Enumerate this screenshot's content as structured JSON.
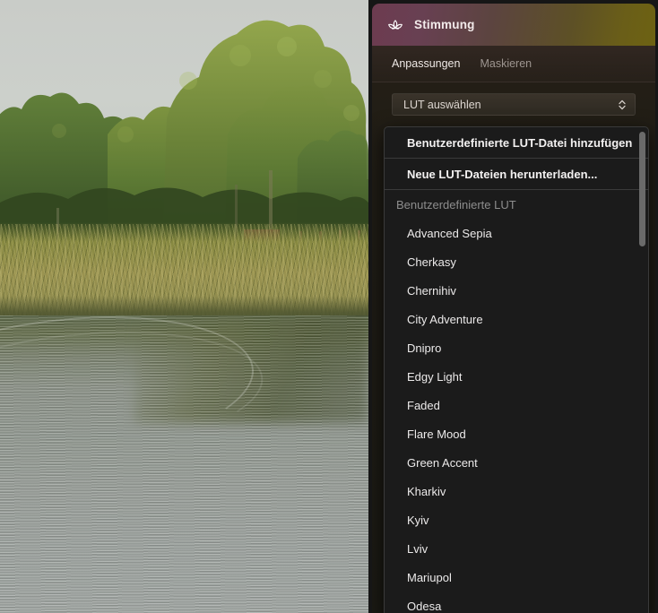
{
  "photo": {
    "alt_description": "Riverbank with green trees, golden reeds and rippled water"
  },
  "panel": {
    "header": {
      "icon": "lotus-icon",
      "title": "Stimmung"
    },
    "tabs": [
      {
        "label": "Anpassungen",
        "active": true
      },
      {
        "label": "Maskieren",
        "active": false
      }
    ],
    "select": {
      "label": "LUT auswählen",
      "icon": "chevron-updown-icon"
    },
    "dropdown": {
      "actions": [
        "Benutzerdefinierte LUT-Datei hinzufügen",
        "Neue LUT-Dateien herunterladen..."
      ],
      "group_label": "Benutzerdefinierte LUT",
      "items": [
        "Advanced Sepia",
        "Cherkasy",
        "Chernihiv",
        "City Adventure",
        "Dnipro",
        "Edgy Light",
        "Faded",
        "Flare Mood",
        "Green Accent",
        "Kharkiv",
        "Kyiv",
        "Lviv",
        "Mariupol",
        "Odesa"
      ]
    }
  },
  "colors": {
    "header_gradient_start": "#6d3b50",
    "header_gradient_end": "#6d6212",
    "panel_background": "#1f1c15",
    "dropdown_background": "#1b1b1b",
    "dropdown_border": "#3a3a3a",
    "text_primary": "#eceaea",
    "text_muted": "#8d8d8d",
    "scrollbar_thumb": "#6a6a6a"
  }
}
